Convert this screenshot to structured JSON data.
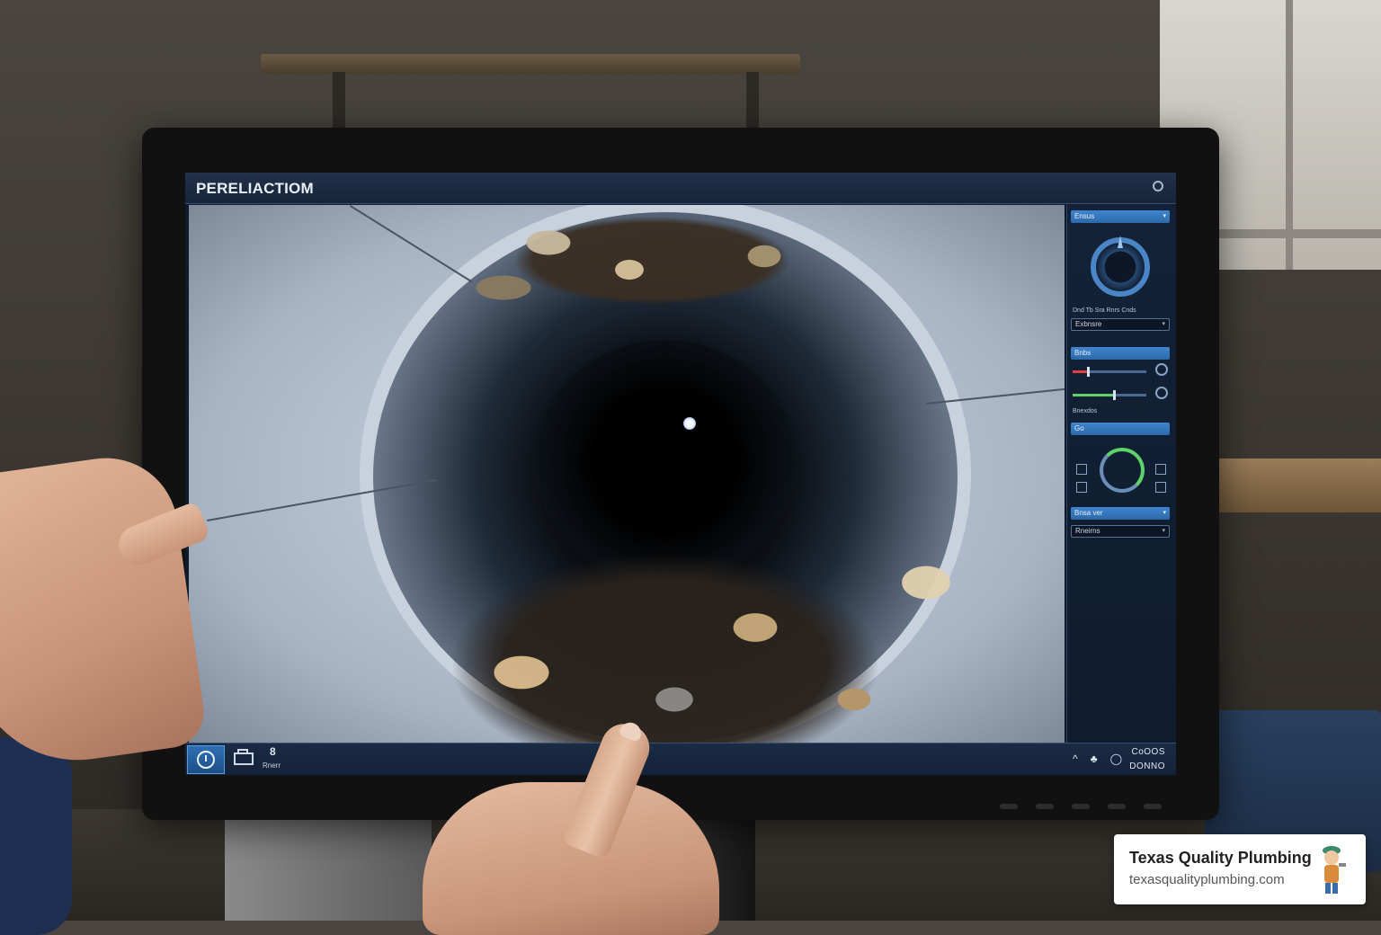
{
  "screen": {
    "title": "PERELIACTIOM"
  },
  "panel": {
    "top_dropdown": "Ensus",
    "labels_row": "Dnd  Tb  Sra  Rnrs  Cnds",
    "field_1": "Exbnsre",
    "section_2": "Bnbs",
    "levels_label": "Bnexdos",
    "section_3": "Go",
    "dropdown_2": "Bnsa ver",
    "field_2": "Rneirns"
  },
  "toolbar": {
    "tool_number": "8",
    "tool_label": "Rnerr",
    "status_top": "CoOOS",
    "status_bottom": "DONNO",
    "status_icons": [
      "^",
      "&#9827;",
      "&#9711;",
      "&#9639;"
    ]
  },
  "badge": {
    "name": "Texas Quality Plumbing",
    "url": "texasqualityplumbing.com"
  },
  "colors": {
    "accent": "#2d68a8",
    "signal_red": "#e04040",
    "signal_green": "#5fd36a"
  },
  "levels": [
    {
      "color": "#e04040",
      "fraction": 0.2
    },
    {
      "color": "#5fd36a",
      "fraction": 0.55
    }
  ]
}
